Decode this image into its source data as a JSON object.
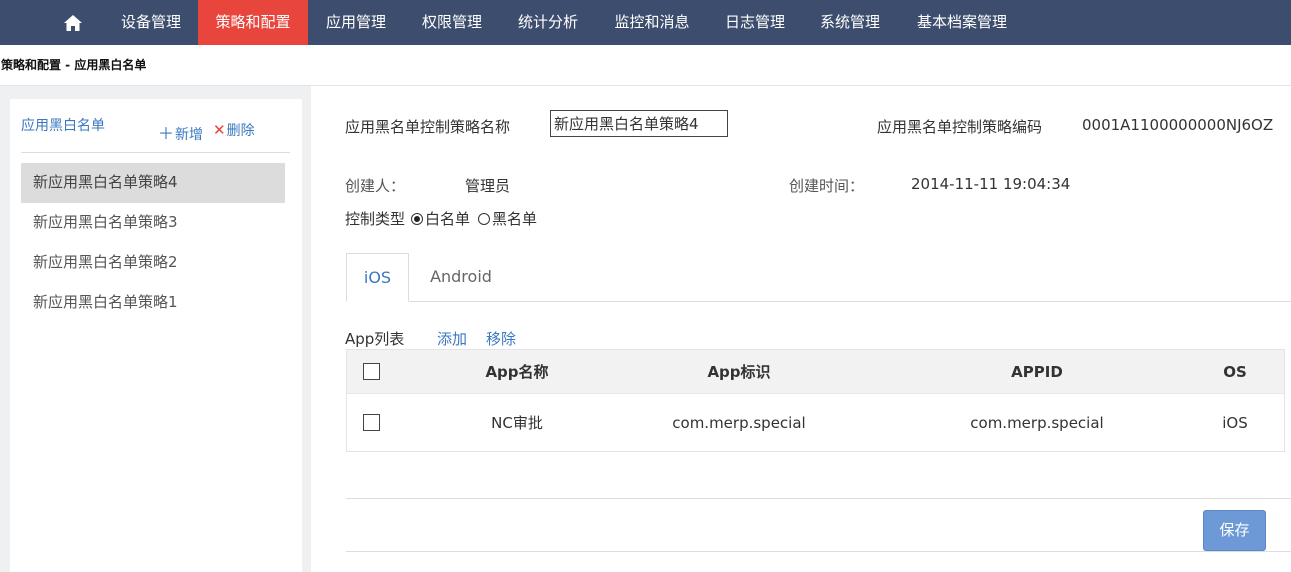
{
  "nav": {
    "home_icon": "home-icon",
    "items": [
      "设备管理",
      "策略和配置",
      "应用管理",
      "权限管理",
      "统计分析",
      "监控和消息",
      "日志管理",
      "系统管理",
      "基本档案管理"
    ],
    "active_index": 1,
    "active_color": "#e8453c",
    "bar_color": "#3d4d6e"
  },
  "breadcrumb": "策略和配置 -  应用黑白名单",
  "sidebar": {
    "title": "应用黑白名单",
    "add_label": "新增",
    "add_icon": "plus-icon",
    "delete_label": "删除",
    "delete_icon": "close-icon",
    "items": [
      "新应用黑白名单策略4",
      "新应用黑白名单策略3",
      "新应用黑白名单策略2",
      "新应用黑白名单策略1"
    ],
    "selected_index": 0
  },
  "form": {
    "name_label": "应用黑名单控制策略名称",
    "name_value": "新应用黑白名单策略4",
    "code_label": "应用黑名单控制策略编码",
    "code_value": "0001A1100000000NJ6OZ",
    "creator_label": "创建人：",
    "creator_value": "管理员",
    "created_label": "创建时间：",
    "created_value": "2014-11-11 19:04:34",
    "type_label": "控制类型",
    "type_options": [
      "白名单",
      "黑名单"
    ],
    "type_selected": "白名单"
  },
  "tabs": [
    {
      "label": "iOS",
      "active": true
    },
    {
      "label": "Android",
      "active": false
    }
  ],
  "applist": {
    "label": "App列表",
    "add_link": "添加",
    "remove_link": "移除",
    "columns": [
      "App名称",
      "App标识",
      "APPID",
      "OS"
    ],
    "rows": [
      {
        "name": "NC审批",
        "identifier": "com.merp.special",
        "appid": "com.merp.special",
        "os": "iOS",
        "checked": false
      }
    ]
  },
  "save_label": "保存",
  "accent_color": "#3a78c2",
  "button_color": "#6d9ad6"
}
